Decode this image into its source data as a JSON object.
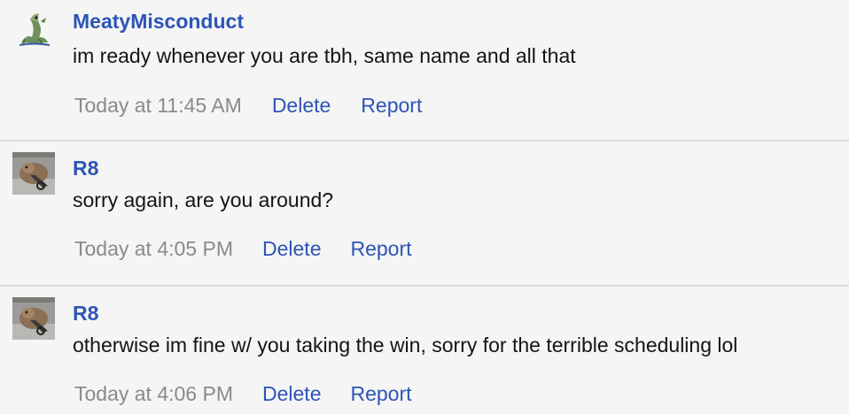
{
  "messages": [
    {
      "username": "MeatyMisconduct",
      "avatar_icon": "lizard-character-icon",
      "text": "im ready whenever you are tbh, same name and all that",
      "timestamp": "Today at 11:45 AM",
      "actions": {
        "delete": "Delete",
        "report": "Report"
      }
    },
    {
      "username": "R8",
      "avatar_icon": "animal-photo-avatar-icon",
      "text": "sorry again, are you around?",
      "timestamp": "Today at 4:05 PM",
      "actions": {
        "delete": "Delete",
        "report": "Report"
      }
    },
    {
      "username": "R8",
      "avatar_icon": "animal-photo-avatar-icon",
      "text": "otherwise im fine w/ you taking the win, sorry for the terrible scheduling lol",
      "timestamp": "Today at 4:06 PM",
      "actions": {
        "delete": "Delete",
        "report": "Report"
      }
    }
  ],
  "colors": {
    "link": "#2d55b6",
    "text": "#141414",
    "muted": "#8a8a8a",
    "background": "#f5f5f5",
    "divider": "#dcdcdc"
  }
}
